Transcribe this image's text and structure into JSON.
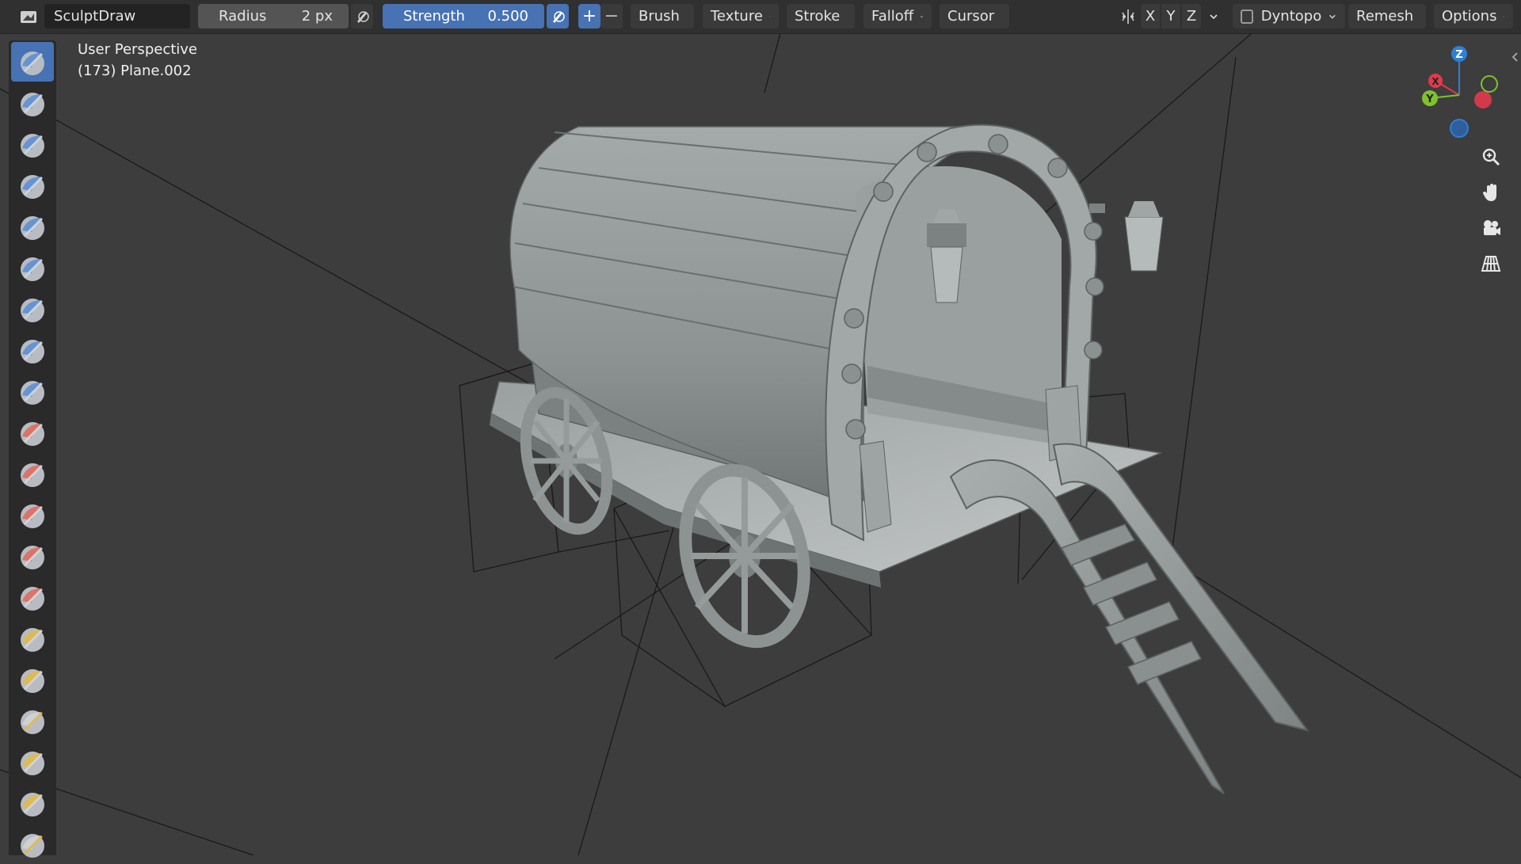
{
  "header": {
    "brush_name": "SculptDraw",
    "radius_label": "Radius",
    "radius_value": "2 px",
    "strength_label": "Strength",
    "strength_value": "0.500",
    "plus": "+",
    "minus": "−",
    "menus": [
      "Brush",
      "Texture",
      "Stroke",
      "Falloff",
      "Cursor"
    ],
    "axes": [
      "X",
      "Y",
      "Z"
    ],
    "dyntopo_label": "Dyntopo",
    "remesh_label": "Remesh",
    "options_label": "Options"
  },
  "viewport": {
    "perspective": "User Perspective",
    "object": "(173) Plane.002"
  },
  "gizmo": {
    "axes": [
      "Z",
      "X",
      "Y"
    ],
    "colors": {
      "x": "#e2394d",
      "y": "#7fc22b",
      "z": "#2e7fd8"
    }
  },
  "toolbar": {
    "tools": [
      "draw-tool",
      "draw-sharp-tool",
      "clay-tool",
      "clay-strips-tool",
      "clay-thumb-tool",
      "layer-tool",
      "inflate-tool",
      "blob-tool",
      "crease-tool",
      "smooth-tool",
      "flatten-tool",
      "fill-tool",
      "scrape-tool",
      "multiplane-scrape-tool",
      "pinch-tool",
      "grab-tool",
      "elastic-deform-tool",
      "snake-hook-tool",
      "thumb-tool",
      "pose-tool"
    ]
  },
  "nav": [
    "zoom-icon",
    "pan-hand-icon",
    "camera-icon",
    "grid-perspective-icon"
  ],
  "colors": {
    "accent": "#4772b3",
    "header_bg": "#303030",
    "viewport_bg": "#3d3d3d"
  }
}
